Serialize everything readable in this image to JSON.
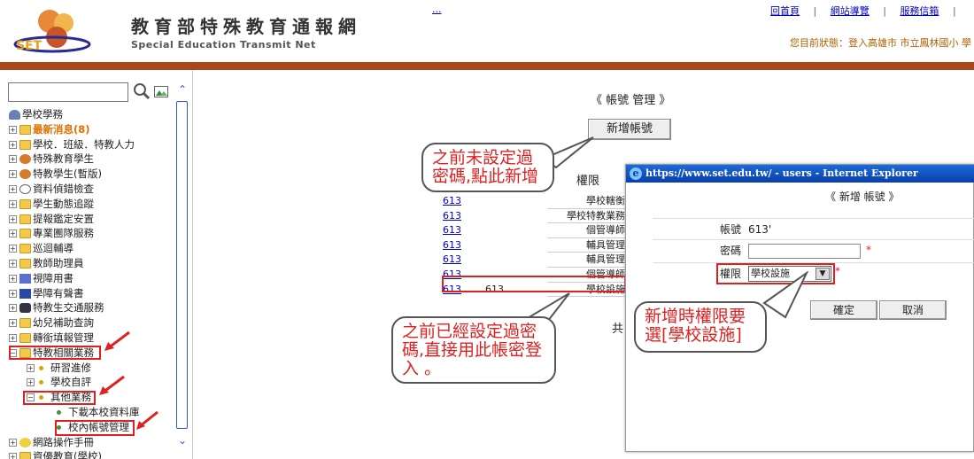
{
  "header": {
    "site_title": "教育部特殊教育通報網",
    "site_subtitle": "Special Education Transmit Net",
    "logo_text": "SET",
    "top_ellipsis": "...",
    "links": [
      "回首頁",
      "網站導覽",
      "服務信箱"
    ],
    "separator": "|",
    "login_status": "您目前狀態：登入高雄市 市立鳳林國小 學"
  },
  "sidebar": {
    "search_placeholder": "",
    "items": [
      {
        "label": "學校學務",
        "type": "root"
      },
      {
        "label": "最新消息(8)",
        "type": "folder",
        "highlight": true
      },
      {
        "label": "學校．班級．特教人力",
        "type": "folder"
      },
      {
        "label": "特殊教育學生",
        "type": "people"
      },
      {
        "label": "特教學生(暫版)",
        "type": "people"
      },
      {
        "label": "資料偵錯檢查",
        "type": "info"
      },
      {
        "label": "學生動態追蹤",
        "type": "folder"
      },
      {
        "label": "提報鑑定安置",
        "type": "folder"
      },
      {
        "label": "專業團隊服務",
        "type": "folder"
      },
      {
        "label": "巡迴輔導",
        "type": "folder"
      },
      {
        "label": "教師助理員",
        "type": "folder"
      },
      {
        "label": "視障用書",
        "type": "pen"
      },
      {
        "label": "學障有聲書",
        "type": "book"
      },
      {
        "label": "特教生交通服務",
        "type": "car"
      },
      {
        "label": "幼兒補助查詢",
        "type": "folder"
      },
      {
        "label": "轉銜填報管理",
        "type": "folder"
      },
      {
        "label": "特教相關業務",
        "type": "folder-open"
      },
      {
        "label": "研習進修",
        "type": "sub"
      },
      {
        "label": "學校自評",
        "type": "sub"
      },
      {
        "label": "其他業務",
        "type": "sub-open"
      },
      {
        "label": "下載本校資料庫",
        "type": "leaf"
      },
      {
        "label": "校內帳號管理",
        "type": "leaf"
      },
      {
        "label": "網路操作手冊",
        "type": "bulb"
      },
      {
        "label": "資優教育(學校)",
        "type": "folder"
      }
    ]
  },
  "main": {
    "page_title": "《 帳號 管理 》",
    "add_button": "新增帳號",
    "callout_top": "之前未設定過密碼,點此新增",
    "callout_bottom": "之前已經設定過密碼,直接用此帳密登入 。",
    "table_header": "權限",
    "rows": [
      {
        "account": "613",
        "name": "",
        "role": "學校轄衡"
      },
      {
        "account": "613",
        "name": "",
        "role": "學校特教業務"
      },
      {
        "account": "613",
        "name": "",
        "role": "個管導師"
      },
      {
        "account": "613",
        "name": "",
        "role": "輔具管理"
      },
      {
        "account": "613",
        "name": "",
        "role": "輔具管理"
      },
      {
        "account": "613",
        "name": "",
        "role": "個管導師"
      },
      {
        "account": "613",
        "name": "613",
        "role": "學校設施"
      }
    ],
    "total_label": "共"
  },
  "popup": {
    "window_title": "https://www.set.edu.tw/ - users - Internet Explorer",
    "heading": "《 新增 帳號 》",
    "account_label": "帳號",
    "account_value": "613'",
    "password_label": "密碼",
    "password_value": "",
    "required_mark": "*",
    "role_label": "權限",
    "role_selected": "學校設施",
    "confirm_button": "確定",
    "cancel_button": "取消",
    "callout": "新增時權限要選[學校設施]"
  },
  "colors": {
    "header_bar": "#a9481a",
    "annotation_red": "#e02020",
    "link_blue": "#0000cc",
    "title_bar_blue": "#1d6ad9"
  }
}
